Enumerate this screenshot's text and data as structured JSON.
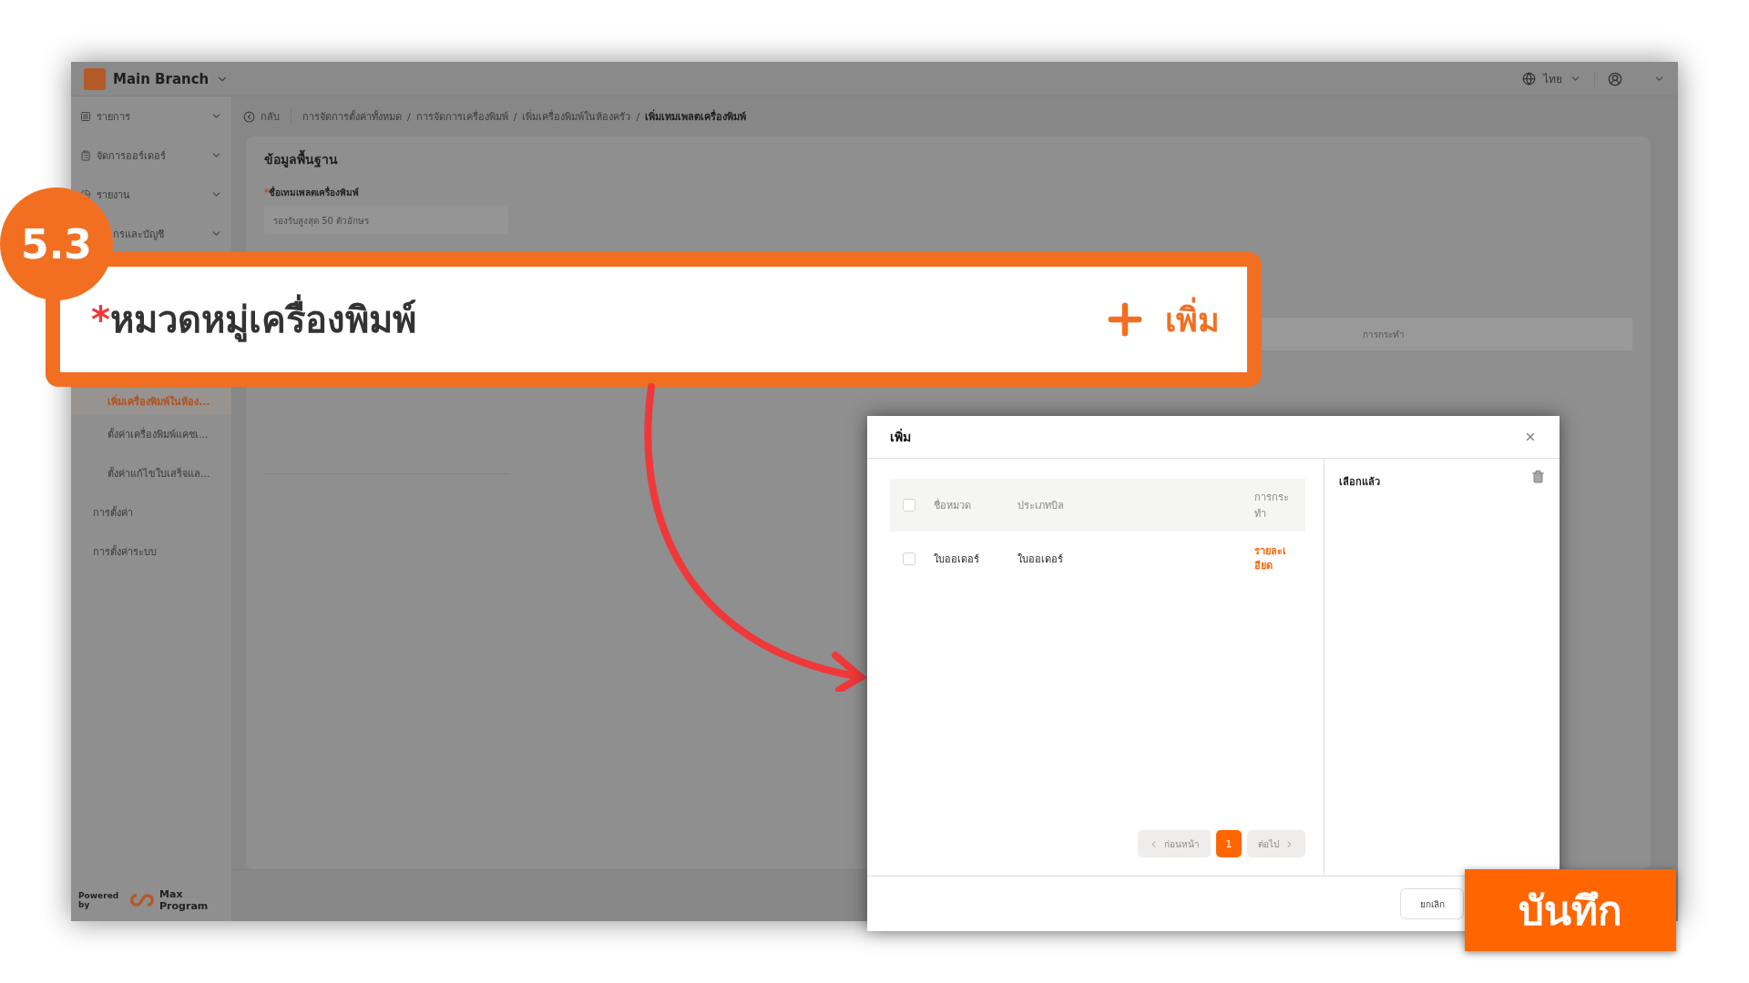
{
  "header": {
    "branch": "Main Branch",
    "language": "ไทย"
  },
  "sidebar": {
    "items": [
      {
        "label": "รายการ",
        "kind": "group",
        "selected": false
      },
      {
        "label": "จัดการออร์เดอร์",
        "kind": "group",
        "selected": false
      },
      {
        "label": "รายงาน",
        "kind": "group",
        "selected": false
      },
      {
        "label": "กรและบัญชี",
        "kind": "partial",
        "selected": false
      },
      {
        "label": "เพิ่มเครื่องพิมพ์ในห้อง...",
        "kind": "sub",
        "selected": true
      },
      {
        "label": "ตั้งค่าเครื่องพิมพ์แคชเ...",
        "kind": "sub",
        "selected": false
      },
      {
        "label": "ตั้งค่าแก้ไขใบเสร็จแล...",
        "kind": "sub",
        "selected": false
      },
      {
        "label": "การตั้งค่า",
        "kind": "plain",
        "selected": false
      },
      {
        "label": "การตั้งค่าระบบ",
        "kind": "plain",
        "selected": false
      }
    ],
    "footer": {
      "powered_by": "Powered by",
      "brand": "Max Program"
    }
  },
  "breadcrumb": {
    "back": "กลับ",
    "separator": "/",
    "items": [
      "การจัดการตั้งค่าทั้งหมด",
      "การจัดการเครื่องพิมพ์",
      "เพิ่มเครื่องพิมพ์ในห้องครัว",
      "เพิ่มเทมเพลตเครื่องพิมพ์"
    ]
  },
  "form": {
    "section_title": "ข้อมูลพื้นฐาน",
    "name_label": "ชื่อเทมเพลตเครื่องพิมพ์",
    "required_mark": "*",
    "name_placeholder": "รองรับสูงสุด 50 ตัวอักษร",
    "table_action_header": "การกระทำ"
  },
  "callout": {
    "step": "5.3",
    "label": "หมวดหมู่เครื่องพิมพ์",
    "required_mark": "*",
    "add_label": "เพิ่ม"
  },
  "dialog": {
    "title": "เพิ่ม",
    "columns": [
      "ชื่อหมวด",
      "ประเภทบิล",
      "การกระทำ"
    ],
    "header_checked": false,
    "rows": [
      {
        "name": "ใบออเดอร์",
        "bill_type": "ใบออเดอร์",
        "action": "รายละเอียด",
        "checked": false
      }
    ],
    "pagination": {
      "prev": "ก่อนหน้า",
      "next": "ต่อไป",
      "prev_disabled": true,
      "next_disabled": true,
      "pages": [
        {
          "label": "1",
          "selected": true
        }
      ]
    },
    "selected_title": "เลือกแล้ว",
    "cancel": "ยกเลิก"
  },
  "save_callout": {
    "label": "บันทึก"
  }
}
